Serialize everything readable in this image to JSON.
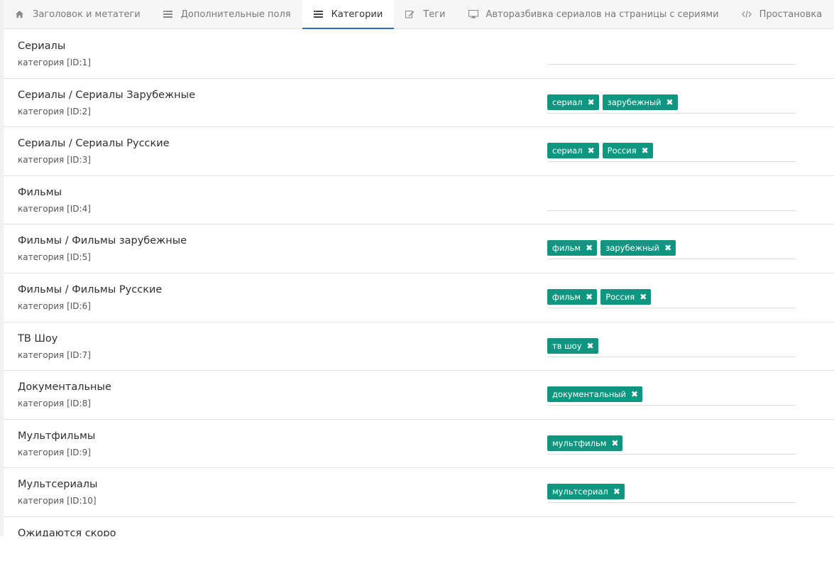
{
  "tabs": [
    {
      "label": "Заголовок и метатеги",
      "icon": "home-icon",
      "active": false
    },
    {
      "label": "Дополнительные поля",
      "icon": "list-icon",
      "active": false
    },
    {
      "label": "Категории",
      "icon": "list-icon",
      "active": true
    },
    {
      "label": "Теги",
      "icon": "edit-icon",
      "active": false
    },
    {
      "label": "Авторазбивка сериалов на страницы с сериями",
      "icon": "monitor-icon",
      "active": false
    },
    {
      "label": "Простановка",
      "icon": "code-icon",
      "active": false
    }
  ],
  "categories": [
    {
      "title": "Сериалы",
      "sub": "категория [ID:1]",
      "tags": []
    },
    {
      "title": "Сериалы / Сериалы Зарубежные",
      "sub": "категория [ID:2]",
      "tags": [
        "сериал",
        "зарубежный"
      ]
    },
    {
      "title": "Сериалы / Сериалы Русские",
      "sub": "категория [ID:3]",
      "tags": [
        "сериал",
        "Россия"
      ]
    },
    {
      "title": "Фильмы",
      "sub": "категория [ID:4]",
      "tags": []
    },
    {
      "title": "Фильмы / Фильмы зарубежные",
      "sub": "категория [ID:5]",
      "tags": [
        "фильм",
        "зарубежный"
      ]
    },
    {
      "title": "Фильмы / Фильмы Русские",
      "sub": "категория [ID:6]",
      "tags": [
        "фильм",
        "Россия"
      ]
    },
    {
      "title": "ТВ Шоу",
      "sub": "категория [ID:7]",
      "tags": [
        "тв шоу"
      ]
    },
    {
      "title": "Документальные",
      "sub": "категория [ID:8]",
      "tags": [
        "документальный"
      ]
    },
    {
      "title": "Мультфильмы",
      "sub": "категория [ID:9]",
      "tags": [
        "мультфильм"
      ]
    },
    {
      "title": "Мультсериалы",
      "sub": "категория [ID:10]",
      "tags": [
        "мультсериал"
      ]
    },
    {
      "title": "Ожидаются скоро",
      "sub": "",
      "tags": []
    }
  ],
  "tag_remove_glyph": "✖",
  "colors": {
    "tag_bg": "#0f9680",
    "active_tab_underline": "#2c6fbb"
  }
}
